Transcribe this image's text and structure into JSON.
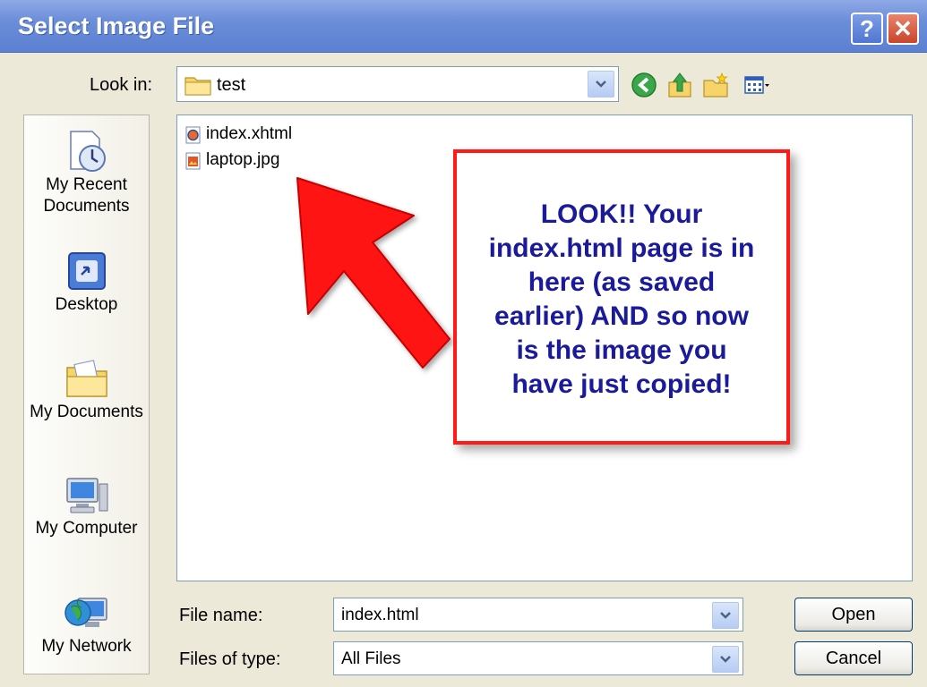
{
  "window": {
    "title": "Select Image File",
    "help_glyph": "?",
    "close_glyph": "✕"
  },
  "look_in": {
    "label": "Look in:",
    "value": "test"
  },
  "toolbar": {
    "icons": [
      "back-icon",
      "up-folder-icon",
      "new-folder-icon",
      "view-menu-icon"
    ]
  },
  "places": [
    {
      "name": "recent",
      "label_line1": "My Recent",
      "label_line2": "Documents"
    },
    {
      "name": "desktop",
      "label_line1": "Desktop"
    },
    {
      "name": "documents",
      "label_line1": "My Documents"
    },
    {
      "name": "computer",
      "label_line1": "My Computer"
    },
    {
      "name": "network",
      "label_line1": "My Network"
    }
  ],
  "files": [
    {
      "name": "index.xhtml",
      "icon": "html-file-icon"
    },
    {
      "name": "laptop.jpg",
      "icon": "jpg-file-icon"
    }
  ],
  "callout": {
    "lines": [
      "LOOK!!  Your",
      "index.html page is in",
      "here (as saved",
      "earlier) AND so now",
      "is the image you",
      "have just copied!"
    ],
    "text_color": "#1a1a9a",
    "border_color": "#ff1a1a"
  },
  "file_name": {
    "label": "File name:",
    "value": "index.html"
  },
  "file_type": {
    "label": "Files of type:",
    "value": "All Files"
  },
  "buttons": {
    "open": "Open",
    "cancel": "Cancel"
  }
}
